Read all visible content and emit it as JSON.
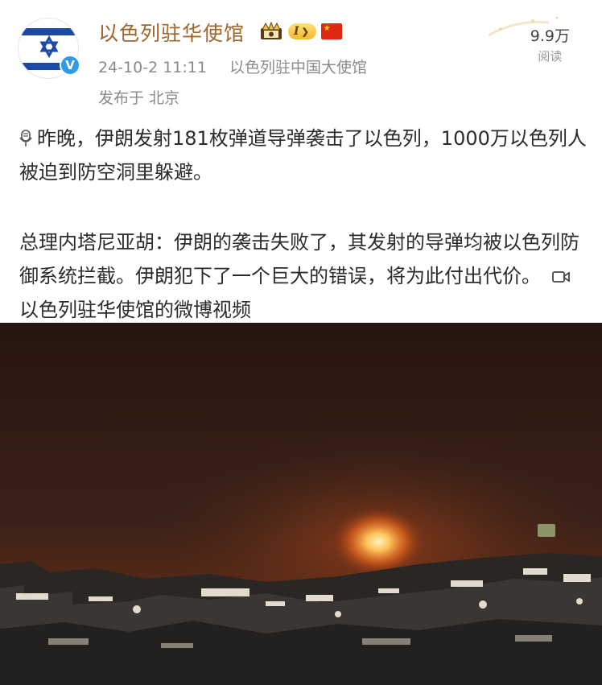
{
  "post": {
    "author": "以色列驻华使馆",
    "level": "I",
    "timestamp": "24-10-2 11:11",
    "source": "以色列驻中国大使馆",
    "location": "发布于 北京",
    "views_count": "9.9万",
    "views_label": "阅读",
    "paragraph1": "昨晚，伊朗发射181枚弹道导弹袭击了以色列，1000万以色列人被迫到防空洞里躲避。",
    "paragraph2": "总理内塔尼亚胡：伊朗的袭击失败了，其发射的导弹均被以色列防御系统拦截。伊朗犯下了一个巨大的错误，将为此付出代价。",
    "video_link": "以色列驻华使馆的微博视频"
  },
  "icons": {
    "avatar": "israel-flag-avatar",
    "verified": "verified-v-icon",
    "crown": "crown-badge-icon",
    "flag": "china-flag-icon",
    "mic": "microphone-icon",
    "video": "video-camera-icon"
  },
  "colors": {
    "author": "#a0652a",
    "verified": "#2f9be8",
    "explosion": "#ff9a2e",
    "sky": "#3a2118"
  }
}
